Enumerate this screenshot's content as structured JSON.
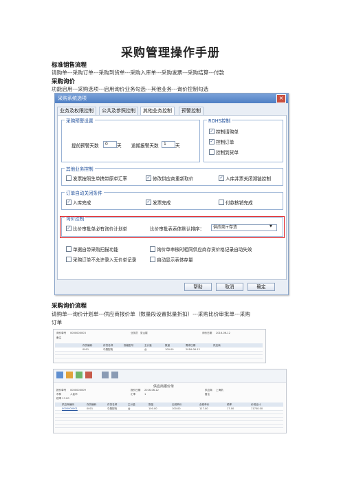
{
  "doc": {
    "title": "采购管理操作手册",
    "s1_heading": "标准销售流程",
    "s1_text": "请购单---采购订单---采购到货单---采购入库单---采购发票---采购结算---付款",
    "s2_heading": "采购询价",
    "s2_text": "功能启用---采购选项---启用询价业务勾选---其他业务---询价控制勾选",
    "s3_heading": "采购询价流程",
    "s3_text_line1": "请购单---询价计划单---供应商报价单（数量段设置批量折扣）---采购比价审批单---采购",
    "s3_text_line2": "订单"
  },
  "dialog": {
    "title": "采购系统选项",
    "close": "×",
    "tabs": [
      "业务及权限控制",
      "公共及参照控制",
      "其他业务控制",
      "预警控制"
    ],
    "active_tab": 2,
    "group_warning": {
      "label": "采购预警设置",
      "advance_label": "提前预警天数",
      "advance_value": "0",
      "overdue_label": "逾期报警天数",
      "overdue_value": "1",
      "unit": "天"
    },
    "group_rohs": {
      "label": "ROHS控制",
      "items": [
        {
          "label": "控制请购单",
          "checked": true
        },
        {
          "label": "控制订单",
          "checked": true
        },
        {
          "label": "控制到货单",
          "checked": false
        }
      ]
    },
    "group_other": {
      "label": "其他业务控制",
      "items": [
        {
          "label": "发票按照生单携带原单汇率",
          "checked": false
        },
        {
          "label": "修改供应商重新取价",
          "checked": true
        },
        {
          "label": "入库并票关闭溯链控制",
          "checked": true
        }
      ]
    },
    "group_auto_close": {
      "label": "订单自动关闭条件",
      "items": [
        {
          "label": "入库完成",
          "checked": true
        },
        {
          "label": "发票完成",
          "checked": true
        },
        {
          "label": "付款核销完成",
          "checked": false
        }
      ]
    },
    "group_inquiry": {
      "label": "询价控制",
      "check_label": "比价审批单必有询价计划单",
      "check_checked": true,
      "sort_label": "比价审批表表体默认排序：",
      "sort_value": "供应商+存货"
    },
    "extra": [
      {
        "label": "单据自带采购扫描功能",
        "checked": false
      },
      {
        "label": "询价单审核时相同供应商存货价格记录自动失效",
        "checked": false
      },
      {
        "label": "采购订单不允许录入无价单记录",
        "checked": false
      },
      {
        "label": "自动显示表体存量",
        "checked": false
      }
    ],
    "buttons": {
      "help": "帮助",
      "cancel": "取消",
      "ok": "确定"
    }
  },
  "screenshot1": {
    "labels": [
      "询价单号",
      "0000000003",
      "业务员",
      "张山楼",
      "询价日期",
      "2016-06-12",
      "备注"
    ],
    "columns": [
      "存货编码",
      "存货名称",
      "规格型号",
      "主计量",
      "数量",
      "需求日期",
      "供应商"
    ],
    "row": [
      "0001",
      "中厨配电",
      "台",
      "100.00",
      "2016-06-12"
    ]
  },
  "screenshot2": {
    "window_title": "供应商报价单",
    "labels": [
      "报价单号",
      "0000000009",
      "报价日期",
      "2016-06-12",
      "供应商",
      "上海机",
      "币种",
      "人民币",
      "汇率",
      "1",
      "备注",
      "税率 17.00"
    ],
    "columns": [
      "供应商编码",
      "存货编码",
      "存货名称",
      "主计量",
      "数量",
      "无税单价",
      "含税单价",
      "税率",
      "价税合计"
    ],
    "row": [
      "0000000001",
      "0001",
      "中厨配电",
      "台",
      "100.00",
      "100.00",
      "117.00",
      "17.00",
      "11700.00"
    ]
  }
}
